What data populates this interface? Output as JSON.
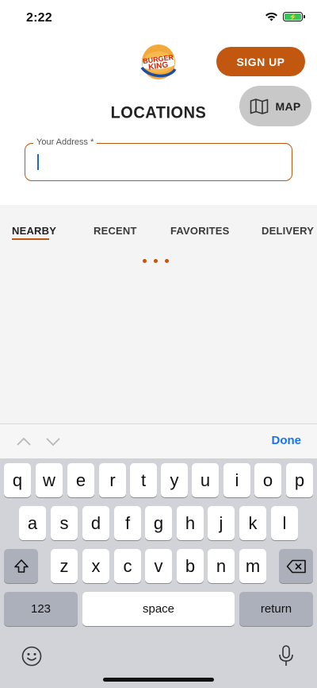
{
  "status_bar": {
    "time": "2:22"
  },
  "header": {
    "logo_text": "BURGER KING",
    "signup_label": "SIGN UP",
    "page_title": "LOCATIONS",
    "map_label": "MAP"
  },
  "address_field": {
    "label": "Your Address *",
    "value": ""
  },
  "tabs": [
    {
      "label": "NEARBY",
      "active": true
    },
    {
      "label": "RECENT",
      "active": false
    },
    {
      "label": "FAVORITES",
      "active": false
    },
    {
      "label": "DELIVERY",
      "active": false
    }
  ],
  "accessory": {
    "done_label": "Done"
  },
  "keyboard": {
    "row1": [
      "q",
      "w",
      "e",
      "r",
      "t",
      "y",
      "u",
      "i",
      "o",
      "p"
    ],
    "row2": [
      "a",
      "s",
      "d",
      "f",
      "g",
      "h",
      "j",
      "k",
      "l"
    ],
    "row3": [
      "z",
      "x",
      "c",
      "v",
      "b",
      "n",
      "m"
    ],
    "numbers_label": "123",
    "space_label": "space",
    "return_label": "return"
  },
  "colors": {
    "brand_orange": "#c2570f",
    "done_blue": "#1a73e8"
  }
}
